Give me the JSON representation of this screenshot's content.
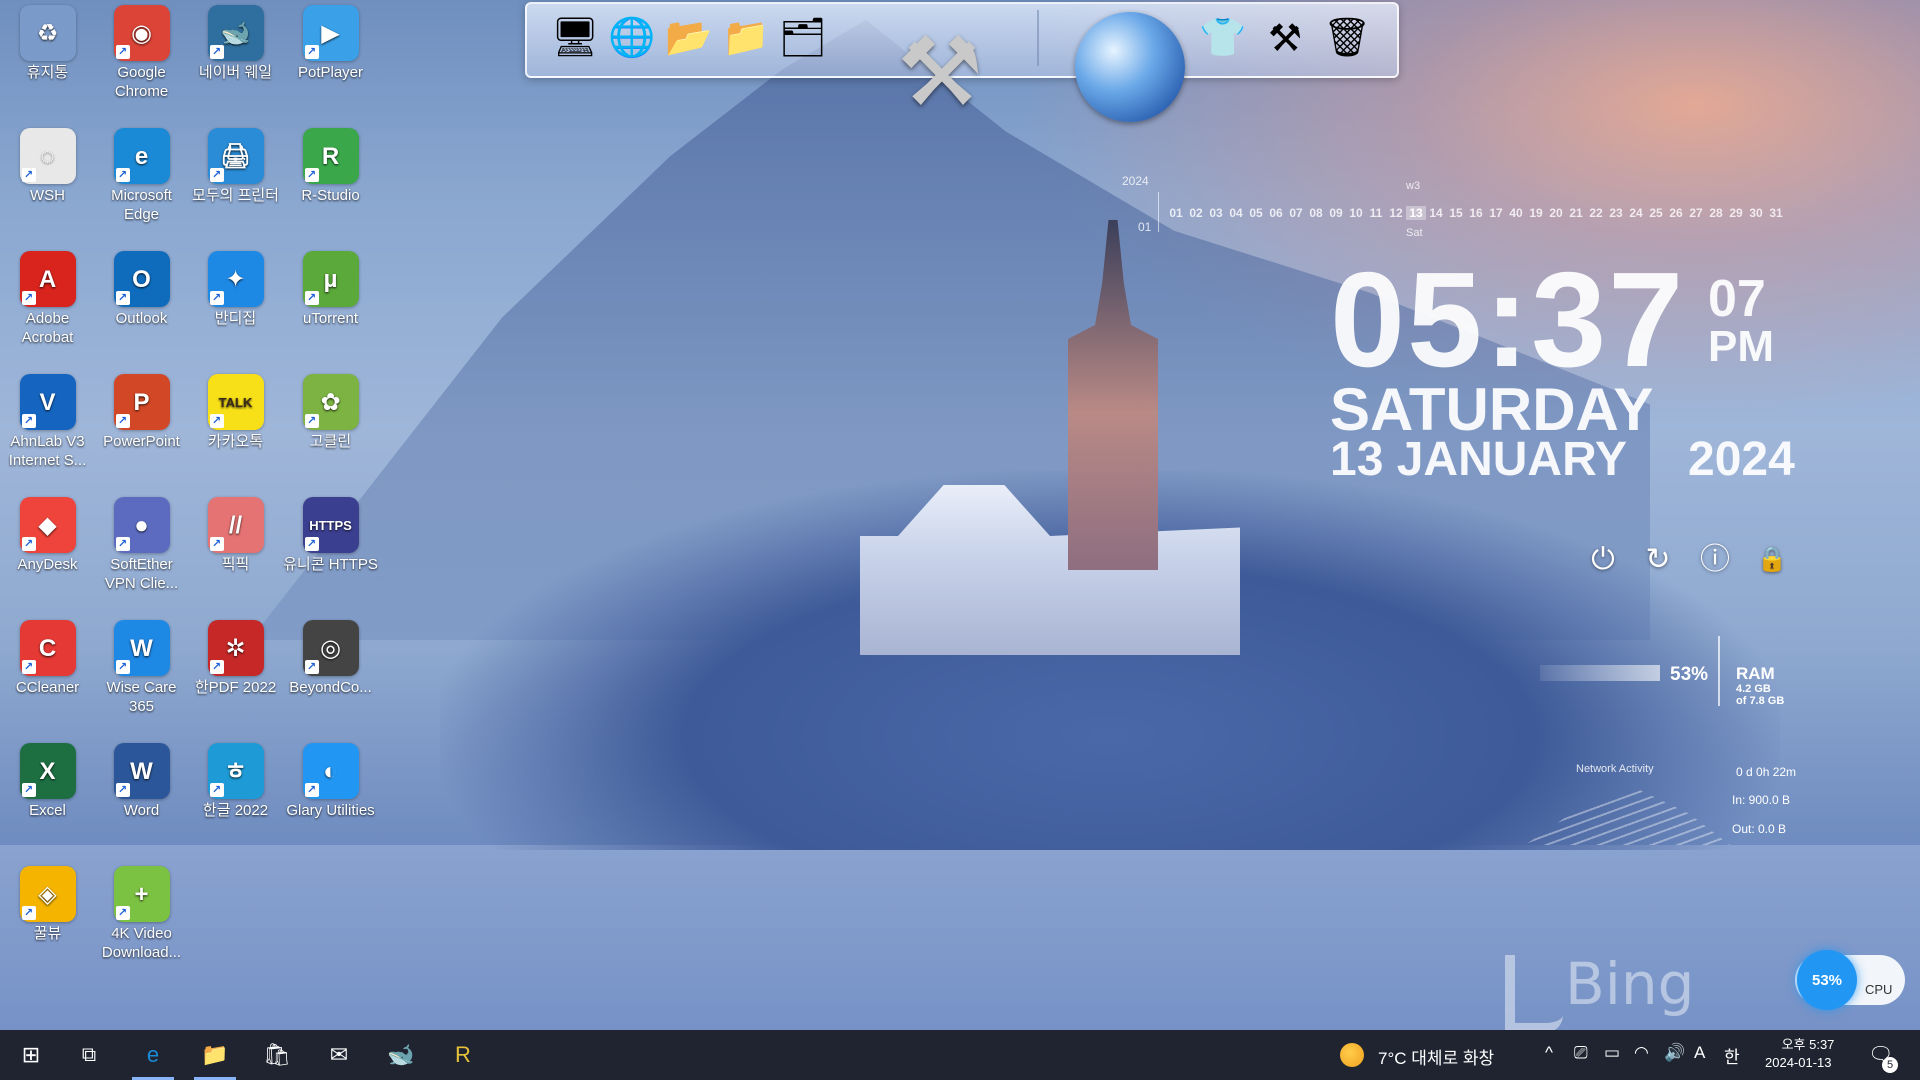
{
  "desktop": {
    "icons": [
      {
        "label": "휴지통",
        "glyph": "♻",
        "color": "#7a9ac9",
        "icon": "recycle-bin-icon"
      },
      {
        "label": "Google Chrome",
        "glyph": "◉",
        "color": "#db4437",
        "icon": "chrome-icon"
      },
      {
        "label": "네이버 웨일",
        "glyph": "🐋",
        "color": "#2f6f9f",
        "icon": "whale-icon"
      },
      {
        "label": "PotPlayer",
        "glyph": "▶",
        "color": "#3aa0e8",
        "icon": "potplayer-icon"
      },
      {
        "label": "WSH",
        "glyph": "◌",
        "color": "#e8e8e8",
        "icon": "wsh-icon"
      },
      {
        "label": "Microsoft Edge",
        "glyph": "e",
        "color": "#1b8ad6",
        "icon": "edge-icon"
      },
      {
        "label": "모두의 프린터",
        "glyph": "🖨",
        "color": "#2a8bd6",
        "icon": "printer-icon"
      },
      {
        "label": "R-Studio",
        "glyph": "R",
        "color": "#3aa84a",
        "icon": "r-studio-icon"
      },
      {
        "label": "Adobe Acrobat",
        "glyph": "A",
        "color": "#d9231d",
        "icon": "acrobat-icon"
      },
      {
        "label": "Outlook",
        "glyph": "O",
        "color": "#0f6cbd",
        "icon": "outlook-icon"
      },
      {
        "label": "반디집",
        "glyph": "✦",
        "color": "#1e88e5",
        "icon": "bandizip-icon"
      },
      {
        "label": "uTorrent",
        "glyph": "µ",
        "color": "#5aa93a",
        "icon": "utorrent-icon"
      },
      {
        "label": "AhnLab V3 Internet S...",
        "glyph": "V",
        "color": "#1565c0",
        "icon": "ahnlab-icon"
      },
      {
        "label": "PowerPoint",
        "glyph": "P",
        "color": "#d24726",
        "icon": "powerpoint-icon"
      },
      {
        "label": "카카오톡",
        "glyph": "TALK",
        "color": "#f7e017",
        "icon": "kakaotalk-icon"
      },
      {
        "label": "고클린",
        "glyph": "✿",
        "color": "#7cb342",
        "icon": "goclean-icon"
      },
      {
        "label": "AnyDesk",
        "glyph": "◆",
        "color": "#ef443b",
        "icon": "anydesk-icon"
      },
      {
        "label": "SoftEther VPN Clie...",
        "glyph": "●",
        "color": "#5c6bc0",
        "icon": "softether-icon"
      },
      {
        "label": "픽픽",
        "glyph": "//",
        "color": "#e57373",
        "icon": "picpick-icon"
      },
      {
        "label": "유니콘 HTTPS",
        "glyph": "HTTPS",
        "color": "#3b3f8f",
        "icon": "unicorn-https-icon"
      },
      {
        "label": "CCleaner",
        "glyph": "C",
        "color": "#e53935",
        "icon": "ccleaner-icon"
      },
      {
        "label": "Wise Care 365",
        "glyph": "W",
        "color": "#1e88e5",
        "icon": "wise-care-icon"
      },
      {
        "label": "한PDF 2022",
        "glyph": "✲",
        "color": "#c62828",
        "icon": "hanpdf-icon"
      },
      {
        "label": "BeyondCo...",
        "glyph": "◎",
        "color": "#444444",
        "icon": "beyond-compare-icon"
      },
      {
        "label": "Excel",
        "glyph": "X",
        "color": "#1d6f42",
        "icon": "excel-icon"
      },
      {
        "label": "Word",
        "glyph": "W",
        "color": "#2b579a",
        "icon": "word-icon"
      },
      {
        "label": "한글 2022",
        "glyph": "ㅎ",
        "color": "#1e9ad6",
        "icon": "hangul-icon"
      },
      {
        "label": "Glary Utilities",
        "glyph": "◐",
        "color": "#2196f3",
        "icon": "glary-icon"
      },
      {
        "label": "꿀뷰",
        "glyph": "◈",
        "color": "#f4b400",
        "icon": "honeyview-icon"
      },
      {
        "label": "4K Video Download...",
        "glyph": "+",
        "color": "#7cc242",
        "icon": "4k-video-icon"
      }
    ]
  },
  "dock": {
    "items": [
      {
        "glyph": "🖥",
        "icon": "computer-icon"
      },
      {
        "glyph": "🌐",
        "icon": "network-icon"
      },
      {
        "glyph": "📂",
        "icon": "documents-folder-icon"
      },
      {
        "glyph": "📁",
        "icon": "folder-icon"
      },
      {
        "glyph": "🗂",
        "icon": "pictures-folder-icon"
      }
    ],
    "right_items": [
      {
        "glyph": "👕",
        "icon": "tshirt-icon"
      },
      {
        "glyph": "⚒",
        "icon": "hammer-icon"
      },
      {
        "glyph": "🗑",
        "icon": "trash-icon"
      }
    ],
    "tools_glyph": "⚒",
    "tools_icon": "tools-icon",
    "globe_icon": "globe-icon"
  },
  "calendar": {
    "year": "2024",
    "month": "01",
    "week": "w3",
    "dayname": "Sat",
    "days": [
      "01",
      "02",
      "03",
      "04",
      "05",
      "06",
      "07",
      "08",
      "09",
      "10",
      "11",
      "12",
      "13",
      "14",
      "15",
      "16",
      "17",
      "40",
      "19",
      "20",
      "21",
      "22",
      "23",
      "24",
      "25",
      "26",
      "27",
      "28",
      "29",
      "30",
      "31"
    ],
    "today": "13"
  },
  "clock": {
    "time": "05:37",
    "seconds": "07",
    "ampm": "PM",
    "weekday": "SATURDAY",
    "date": "13 JANUARY",
    "year": "2024"
  },
  "power_controls": {
    "shutdown_glyph": "⏻",
    "restart_glyph": "↻",
    "sleep_glyph": "ⓘ",
    "lock_glyph": "🔒"
  },
  "system_meter": {
    "ram_percent": "53%",
    "ram_label": "RAM",
    "ram_used": "4.2 GB",
    "ram_total": "of 7.8 GB",
    "network_title": "Network Activity",
    "uptime": "0 d 0h 22m",
    "in": "In: 900.0 B",
    "out": "Out: 0.0 B"
  },
  "watermark": {
    "text": "Bing"
  },
  "cpu_widget": {
    "percent": "53%",
    "label": "CPU"
  },
  "taskbar": {
    "start_glyph": "⊞",
    "taskview_glyph": "⧉",
    "apps": [
      {
        "glyph": "e",
        "icon": "edge-icon",
        "color": "#1b8ad6",
        "active": true
      },
      {
        "glyph": "📁",
        "icon": "file-explorer-icon",
        "color": "#f4c542",
        "active": true
      },
      {
        "glyph": "🛍",
        "icon": "store-icon",
        "color": "#ffffff",
        "active": false
      },
      {
        "glyph": "✉",
        "icon": "mail-icon",
        "color": "#ffffff",
        "active": false
      },
      {
        "glyph": "🐋",
        "icon": "whale-icon",
        "color": "#5cc7d8",
        "active": false
      },
      {
        "glyph": "R",
        "icon": "r-app-icon",
        "color": "#e6c23a",
        "active": false
      }
    ],
    "weather": "7°C  대체로 화창",
    "tray_chevron": "^",
    "tray_icons": [
      "⎚",
      "▭",
      "◠",
      "🔊",
      "A",
      "한"
    ],
    "time": "오후 5:37",
    "date": "2024-01-13",
    "notifications": "5"
  }
}
